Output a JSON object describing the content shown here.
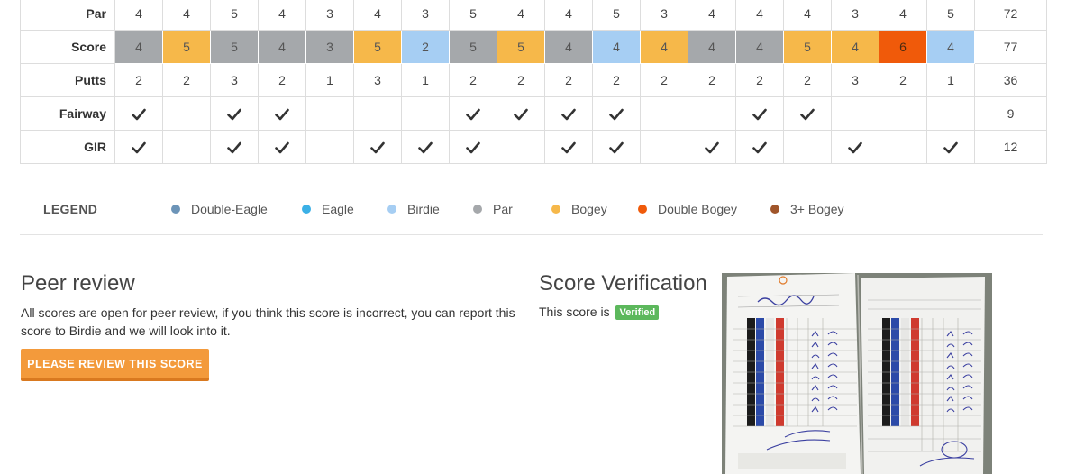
{
  "scorecard": {
    "rows": [
      {
        "key": "par",
        "label": "Par",
        "cells": [
          "4",
          "4",
          "5",
          "4",
          "3",
          "4",
          "3",
          "5",
          "4",
          "4",
          "5",
          "3",
          "4",
          "4",
          "4",
          "3",
          "4",
          "5"
        ],
        "total": "72"
      },
      {
        "key": "score",
        "label": "Score",
        "cells": [
          "4",
          "5",
          "5",
          "4",
          "3",
          "5",
          "2",
          "5",
          "5",
          "4",
          "4",
          "4",
          "4",
          "4",
          "5",
          "4",
          "6",
          "4"
        ],
        "total": "77",
        "results": [
          "par",
          "bogey",
          "par",
          "par",
          "par",
          "bogey",
          "birdie",
          "par",
          "bogey",
          "par",
          "birdie",
          "bogey",
          "par",
          "par",
          "bogey",
          "bogey",
          "double-bogey",
          "birdie"
        ]
      },
      {
        "key": "putts",
        "label": "Putts",
        "cells": [
          "2",
          "2",
          "3",
          "2",
          "1",
          "3",
          "1",
          "2",
          "2",
          "2",
          "2",
          "2",
          "2",
          "2",
          "2",
          "3",
          "2",
          "1"
        ],
        "total": "36"
      },
      {
        "key": "fairway",
        "label": "Fairway",
        "checks": [
          1,
          0,
          1,
          1,
          0,
          0,
          0,
          1,
          1,
          1,
          1,
          0,
          0,
          1,
          1,
          0,
          0,
          0
        ],
        "total": "9"
      },
      {
        "key": "gir",
        "label": "GIR",
        "checks": [
          1,
          0,
          1,
          1,
          0,
          1,
          1,
          1,
          0,
          1,
          1,
          0,
          1,
          1,
          0,
          1,
          0,
          1
        ],
        "total": "12"
      }
    ],
    "result_colors": {
      "par": "#a5a8ab",
      "bogey": "#f6b84a",
      "birdie": "#a6cef3",
      "double-bogey": "#f05a0a"
    },
    "check_icon": "checkmark-icon"
  },
  "legend": {
    "title": "LEGEND",
    "items": [
      {
        "label": "Double-Eagle",
        "color": "#6c94b8"
      },
      {
        "label": "Eagle",
        "color": "#3bb0e6"
      },
      {
        "label": "Birdie",
        "color": "#a6cef3"
      },
      {
        "label": "Par",
        "color": "#a5a8ab"
      },
      {
        "label": "Bogey",
        "color": "#f6b84a"
      },
      {
        "label": "Double Bogey",
        "color": "#f05a0a"
      },
      {
        "label": "3+ Bogey",
        "color": "#a0552a"
      }
    ]
  },
  "peer_review": {
    "title": "Peer review",
    "text": "All scores are open for peer review, if you think this score is incorrect, you can report this score to Birdie and we will look into it.",
    "button_label": "PLEASE REVIEW THIS SCORE"
  },
  "score_verification": {
    "title": "Score Verification",
    "text": "This score is",
    "badge": "Verified",
    "photo_icon": "scorecard-photo"
  }
}
